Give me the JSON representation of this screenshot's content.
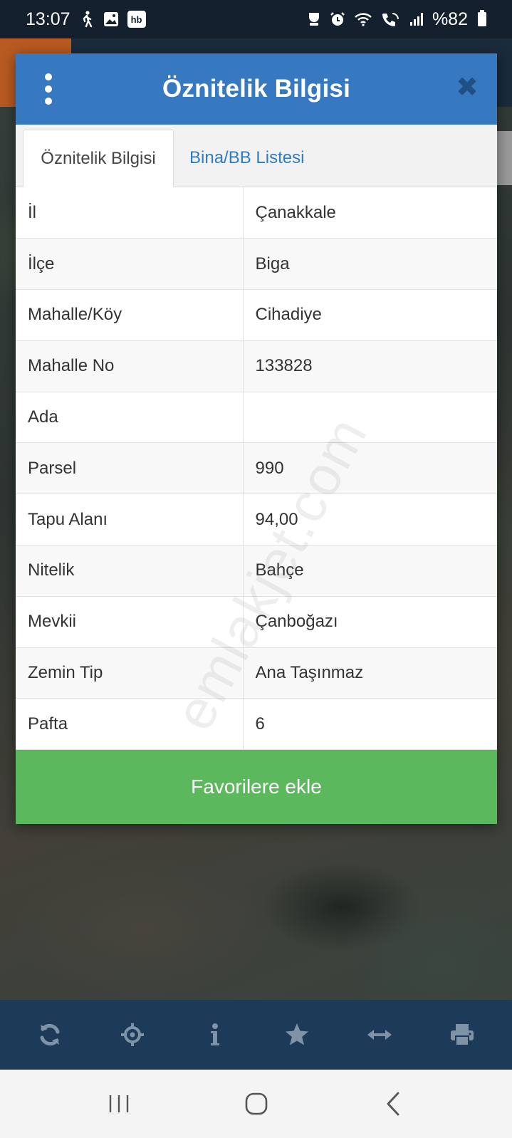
{
  "status_bar": {
    "time": "13:07",
    "battery_text": "%82",
    "left_icons": [
      "walking-icon",
      "image-icon",
      "hb-app-icon"
    ],
    "hb_label": "hb",
    "right_icons": [
      "recycle-icon",
      "alarm-icon",
      "wifi-icon",
      "wifi-calling-icon",
      "signal-icon",
      "battery-icon"
    ]
  },
  "dialog": {
    "title": "Öznitelik Bilgisi",
    "tabs": [
      {
        "label": "Öznitelik Bilgisi",
        "active": true
      },
      {
        "label": "Bina/BB Listesi",
        "active": false
      }
    ],
    "rows": [
      {
        "key": "İl",
        "value": "Çanakkale"
      },
      {
        "key": "İlçe",
        "value": "Biga"
      },
      {
        "key": "Mahalle/Köy",
        "value": "Cihadiye"
      },
      {
        "key": "Mahalle No",
        "value": "133828"
      },
      {
        "key": "Ada",
        "value": ""
      },
      {
        "key": "Parsel",
        "value": "990"
      },
      {
        "key": "Tapu Alanı",
        "value": "94,00"
      },
      {
        "key": "Nitelik",
        "value": "Bahçe"
      },
      {
        "key": "Mevkii",
        "value": "Çanboğazı"
      },
      {
        "key": "Zemin Tip",
        "value": "Ana Taşınmaz"
      },
      {
        "key": "Pafta",
        "value": "6"
      }
    ],
    "favorite_button": "Favorilere ekle"
  },
  "watermark": "emlakjet.com",
  "toolbar": {
    "items": [
      "refresh-icon",
      "locate-icon",
      "info-icon",
      "star-icon",
      "measure-icon",
      "print-icon"
    ]
  },
  "colors": {
    "header": "#3779c0",
    "toolbar": "#1d3b59",
    "status_bar": "#14202d",
    "favorite_button": "#5cb85c",
    "tab_link": "#2f7cc4"
  }
}
